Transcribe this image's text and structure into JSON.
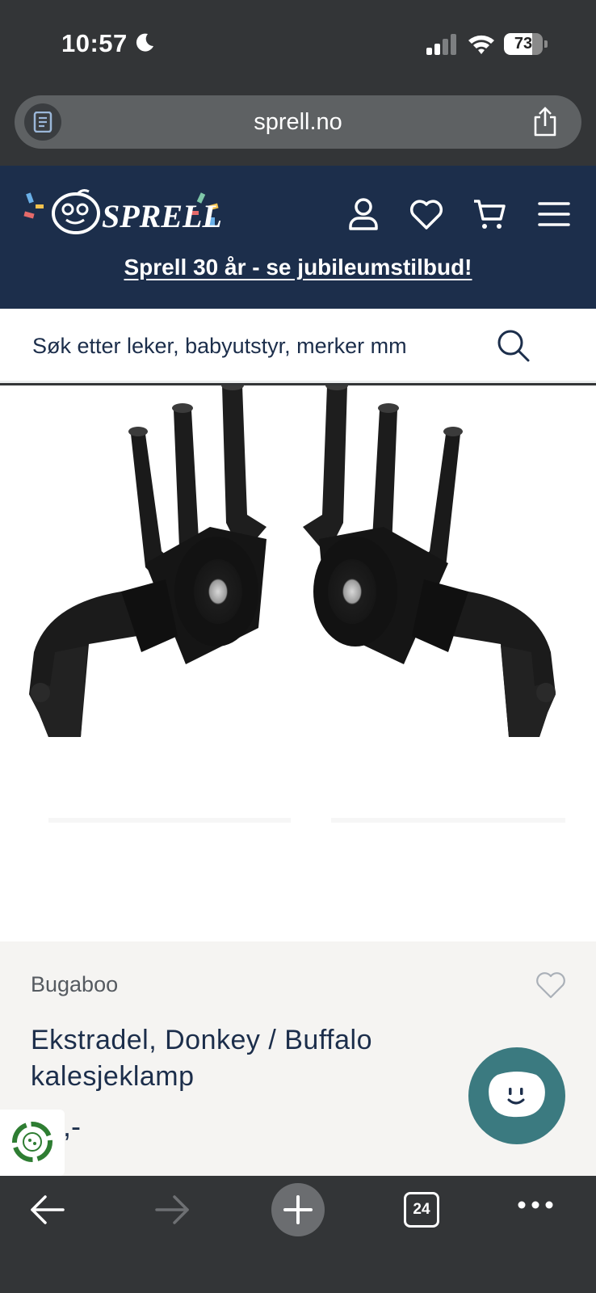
{
  "status_bar": {
    "time": "10:57",
    "battery_level": "73",
    "battery_fraction": 0.73,
    "icons": [
      "moon-icon",
      "signal-icon",
      "wifi-icon",
      "battery-icon"
    ]
  },
  "browser": {
    "url": "sprell.no",
    "tab_count": "24",
    "icons": [
      "reader-icon",
      "share-icon",
      "back-icon",
      "forward-icon",
      "new-tab-icon",
      "tabs-icon",
      "more-icon"
    ]
  },
  "site_header": {
    "logo_text": "SPRELL",
    "icons": [
      "account-icon",
      "heart-icon",
      "cart-icon",
      "menu-icon"
    ],
    "promo_link": "Sprell 30 år - se jubileumstilbud!"
  },
  "search": {
    "placeholder": "Søk etter leker, babyutstyr, merker mm"
  },
  "product": {
    "brand": "Bugaboo",
    "title": "Ekstradel, Donkey / Buffalo kalesjeklamp",
    "price": "40,-"
  },
  "colors": {
    "header_bg": "#1c2e4b",
    "chat_bg": "#3b7a80",
    "info_bg": "#f5f4f2",
    "browser_chrome": "#333537"
  }
}
